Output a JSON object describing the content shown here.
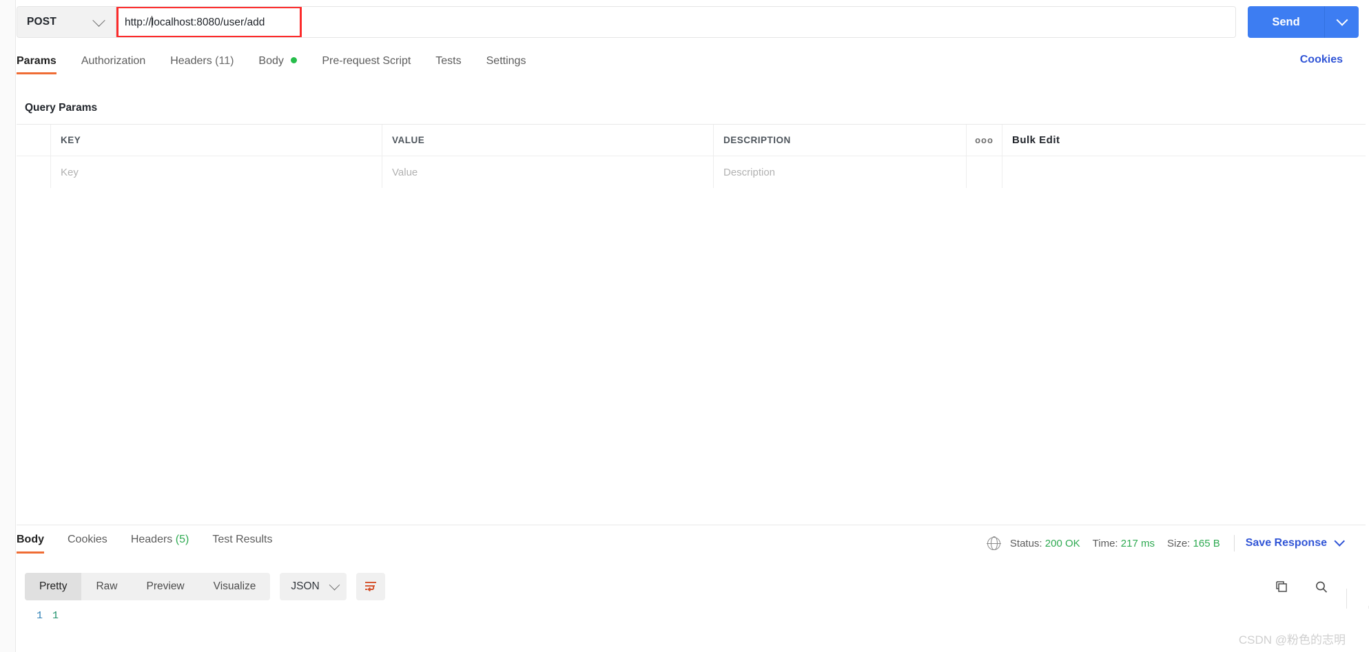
{
  "request": {
    "method": "POST",
    "url": "http://localhost:8080/user/add",
    "send_label": "Send",
    "tabs": [
      {
        "label": "Params",
        "count": "",
        "dot": false
      },
      {
        "label": "Authorization",
        "count": "",
        "dot": false
      },
      {
        "label": "Headers",
        "count": "(11)",
        "dot": false
      },
      {
        "label": "Body",
        "count": "",
        "dot": true
      },
      {
        "label": "Pre-request Script",
        "count": "",
        "dot": false
      },
      {
        "label": "Tests",
        "count": "",
        "dot": false
      },
      {
        "label": "Settings",
        "count": "",
        "dot": false
      }
    ],
    "cookies_link": "Cookies"
  },
  "params": {
    "section_title": "Query Params",
    "columns": [
      "KEY",
      "VALUE",
      "DESCRIPTION"
    ],
    "dots_label": "ooo",
    "bulk_edit_label": "Bulk Edit",
    "rows": [
      {
        "key_placeholder": "Key",
        "value_placeholder": "Value",
        "description_placeholder": "Description"
      }
    ]
  },
  "response": {
    "tabs": [
      {
        "label": "Body",
        "count": ""
      },
      {
        "label": "Cookies",
        "count": ""
      },
      {
        "label": "Headers",
        "count": "(5)"
      },
      {
        "label": "Test Results",
        "count": ""
      }
    ],
    "status_label": "Status:",
    "status_value": "200 OK",
    "time_label": "Time:",
    "time_value": "217 ms",
    "size_label": "Size:",
    "size_value": "165 B",
    "save_response_label": "Save Response",
    "view_modes": [
      "Pretty",
      "Raw",
      "Preview",
      "Visualize"
    ],
    "active_view_mode": "Pretty",
    "format": "JSON",
    "body_lines": [
      {
        "number": "1",
        "content": "1"
      }
    ]
  },
  "watermark": "CSDN @粉色的志明",
  "colors": {
    "accent": "#ef6c34",
    "send_blue": "#3d7df2",
    "link_blue": "#3155d6",
    "success_green": "#2faa52",
    "highlight_red": "#fc2b2b"
  }
}
